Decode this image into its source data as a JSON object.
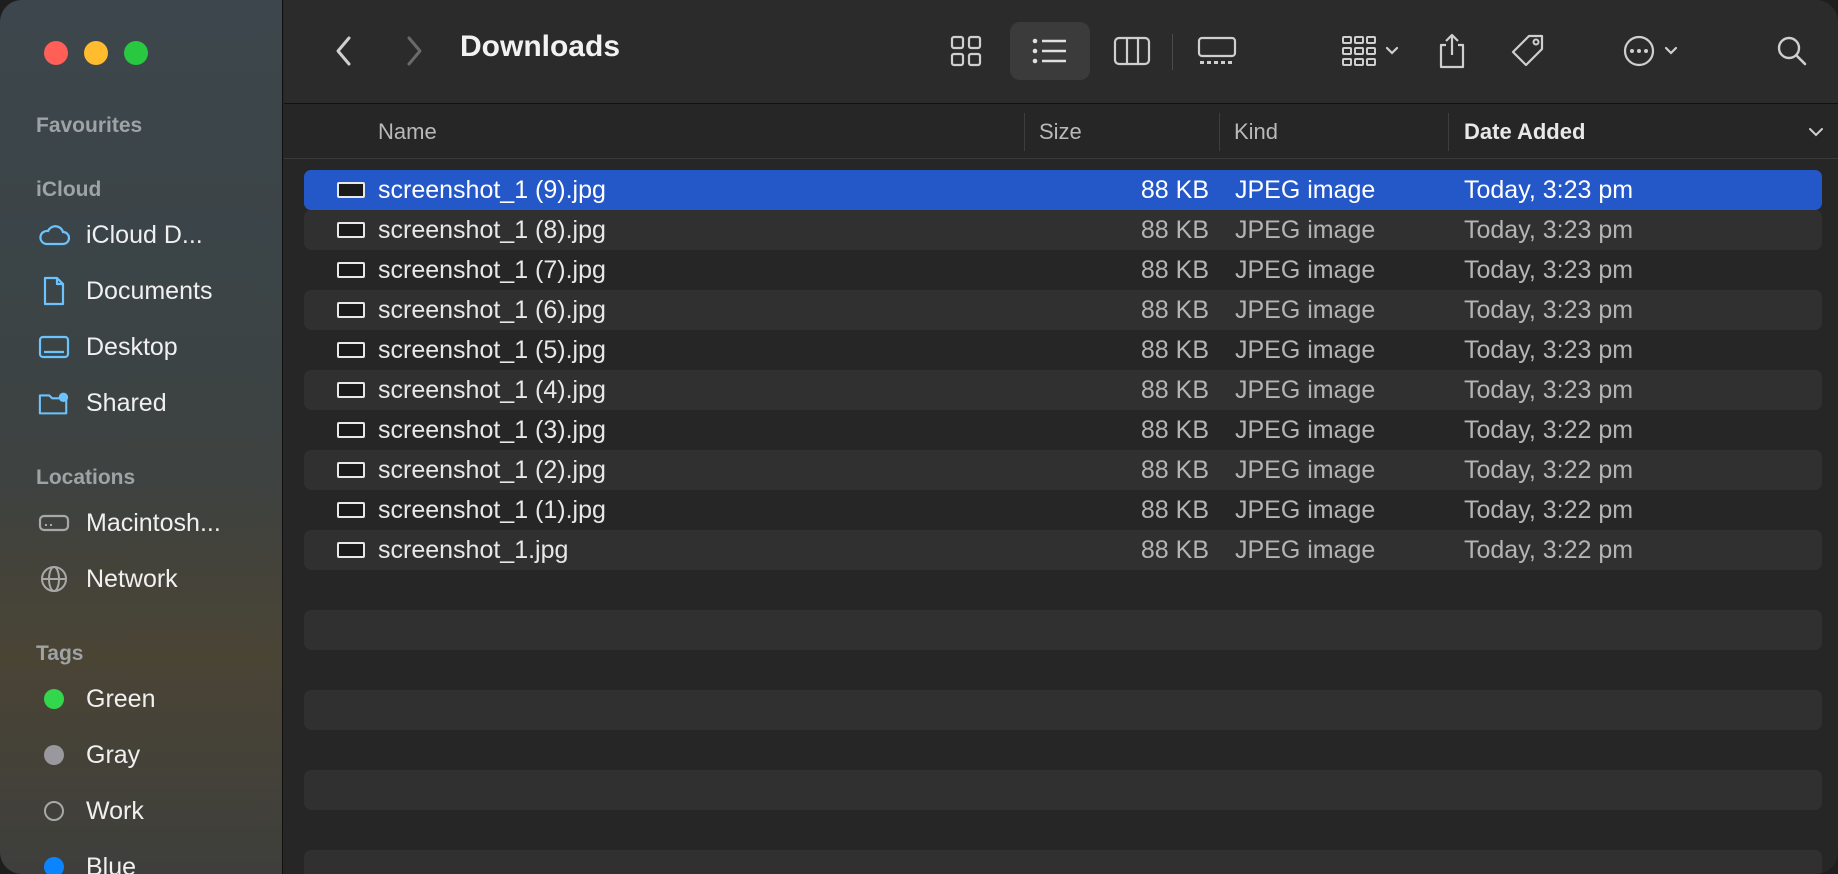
{
  "window": {
    "title": "Downloads"
  },
  "sidebar": {
    "sections": {
      "favourites": "Favourites",
      "icloud": "iCloud",
      "locations": "Locations",
      "tags": "Tags"
    },
    "icloud_items": [
      {
        "label": "iCloud D...",
        "icon": "cloud-icon"
      },
      {
        "label": "Documents",
        "icon": "document-icon"
      },
      {
        "label": "Desktop",
        "icon": "desktop-icon"
      },
      {
        "label": "Shared",
        "icon": "shared-folder-icon"
      }
    ],
    "location_items": [
      {
        "label": "Macintosh...",
        "icon": "drive-icon"
      },
      {
        "label": "Network",
        "icon": "globe-icon"
      }
    ],
    "tag_items": [
      {
        "label": "Green",
        "color": "#32d74b"
      },
      {
        "label": "Gray",
        "color": "#98989d"
      },
      {
        "label": "Work",
        "color": "none"
      },
      {
        "label": "Blue",
        "color": "#0a84ff"
      }
    ]
  },
  "toolbar": {
    "back_icon": "chevron-left-icon",
    "forward_icon": "chevron-right-icon",
    "views": [
      "icon-view-icon",
      "list-view-icon",
      "column-view-icon",
      "gallery-view-icon"
    ],
    "active_view": "list-view-icon",
    "group_icon": "group-icon",
    "share_icon": "share-icon",
    "tag_icon": "tag-icon",
    "more_icon": "ellipsis-circle-icon",
    "search_icon": "search-icon"
  },
  "columns": {
    "name": "Name",
    "size": "Size",
    "kind": "Kind",
    "date_added": "Date Added"
  },
  "files": [
    {
      "name": "screenshot_1 (9).jpg",
      "size": "88 KB",
      "kind": "JPEG image",
      "date": "Today, 3:23 pm",
      "selected": true
    },
    {
      "name": "screenshot_1 (8).jpg",
      "size": "88 KB",
      "kind": "JPEG image",
      "date": "Today, 3:23 pm"
    },
    {
      "name": "screenshot_1 (7).jpg",
      "size": "88 KB",
      "kind": "JPEG image",
      "date": "Today, 3:23 pm"
    },
    {
      "name": "screenshot_1 (6).jpg",
      "size": "88 KB",
      "kind": "JPEG image",
      "date": "Today, 3:23 pm"
    },
    {
      "name": "screenshot_1 (5).jpg",
      "size": "88 KB",
      "kind": "JPEG image",
      "date": "Today, 3:23 pm"
    },
    {
      "name": "screenshot_1 (4).jpg",
      "size": "88 KB",
      "kind": "JPEG image",
      "date": "Today, 3:23 pm"
    },
    {
      "name": "screenshot_1 (3).jpg",
      "size": "88 KB",
      "kind": "JPEG image",
      "date": "Today, 3:22 pm"
    },
    {
      "name": "screenshot_1 (2).jpg",
      "size": "88 KB",
      "kind": "JPEG image",
      "date": "Today, 3:22 pm"
    },
    {
      "name": "screenshot_1 (1).jpg",
      "size": "88 KB",
      "kind": "JPEG image",
      "date": "Today, 3:22 pm"
    },
    {
      "name": "screenshot_1.jpg",
      "size": "88 KB",
      "kind": "JPEG image",
      "date": "Today, 3:22 pm"
    }
  ],
  "colors": {
    "selection": "#2458c8",
    "sidebar_icon": "#6cc4ff"
  }
}
